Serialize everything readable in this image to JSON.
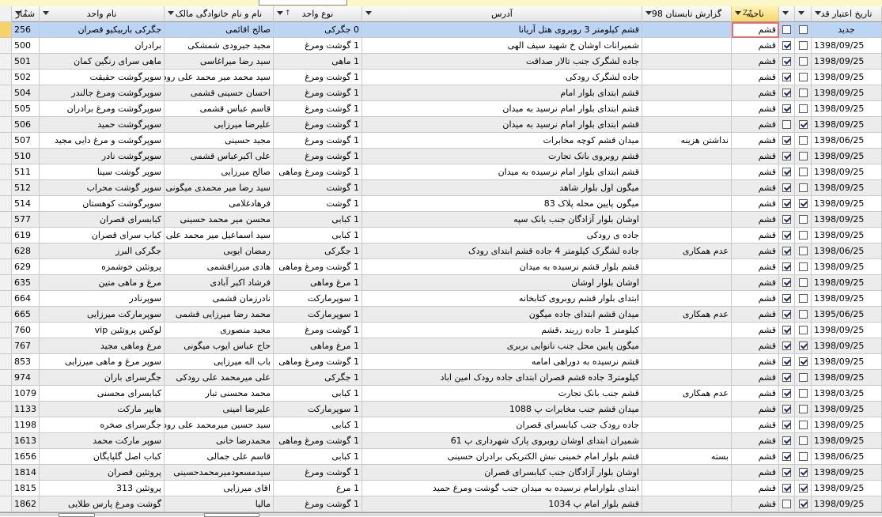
{
  "columns": [
    {
      "key": "num",
      "label": "شمار",
      "sort": true
    },
    {
      "key": "unit_name",
      "label": "نام واحد",
      "sort": false
    },
    {
      "key": "owner",
      "label": "نام و نام خانوادگی مالک",
      "sort": false
    },
    {
      "key": "type",
      "label": "نوع  واحد",
      "sort": true
    },
    {
      "key": "address",
      "label": "آدرس",
      "sort": false
    },
    {
      "key": "report",
      "label": "گزارش تابستان 98",
      "sort": false
    },
    {
      "key": "region",
      "label": "ناحیه",
      "sort": true,
      "sorted": true
    },
    {
      "key": "c1",
      "label": "",
      "sort": false
    },
    {
      "key": "c2",
      "label": "",
      "sort": false
    },
    {
      "key": "date",
      "label": "تاریخ اعتبار قد",
      "sort": false
    }
  ],
  "new_row": {
    "num": "256",
    "unit_name": "جگرکی باربیکیو قصران",
    "owner": "صالح اقائمی",
    "type": "0 جگرکی",
    "address": "قشم کیلومتر 3 روبروی هتل آریانا",
    "report": "",
    "region": "قشم",
    "c1": false,
    "c2": false,
    "date": "جدید"
  },
  "rows": [
    {
      "num": "500",
      "unit_name": "برادران",
      "owner": "مجید جیرودی شمشکی",
      "type": "1 گوشت ومرغ",
      "address": "شمیرانات اوشان خ شهید سیف الهی",
      "report": "",
      "region": "قشم",
      "c1": true,
      "c2": false,
      "date": "1398/09/25"
    },
    {
      "num": "501",
      "unit_name": "ماهی سرای رنگین کمان",
      "owner": "سید رضا میراغاسی",
      "type": "1 ماهی",
      "address": "جاده لشگرک جنب تالار صداقت",
      "report": "",
      "region": "قشم",
      "c1": true,
      "c2": false,
      "date": "1398/09/25"
    },
    {
      "num": "502",
      "unit_name": "سوپرگوشت حقیقت",
      "owner": "سید محمد میر محمد علی رودکی",
      "type": "1 گوشت ومرغ",
      "address": "جاده لشگرک رودکی",
      "report": "",
      "region": "قشم",
      "c1": true,
      "c2": false,
      "date": "1398/09/25"
    },
    {
      "num": "504",
      "unit_name": "سوپرگوشت ومرغ جالندر",
      "owner": "احسان حسینی قشمی",
      "type": "1 گوشت ومرغ",
      "address": "قشم ابتدای بلوار امام",
      "report": "",
      "region": "قشم",
      "c1": true,
      "c2": false,
      "date": "1398/09/25"
    },
    {
      "num": "505",
      "unit_name": "سوپرگوشت ومرغ برادران",
      "owner": "قاسم عباس قشمی",
      "type": "1 گوشت ومرغ",
      "address": "قشم ابتدای بلوار امام نرسید به میدان",
      "report": "",
      "region": "قشم",
      "c1": true,
      "c2": false,
      "date": "1398/09/25"
    },
    {
      "num": "506",
      "unit_name": "سوپرگوشت حمید",
      "owner": "علیرضا میرزایی",
      "type": "1 گوشت ومرغ",
      "address": "قشم ابتدای بلوار امام نرسید به میدان",
      "report": "",
      "region": "قشم",
      "c1": false,
      "c2": true,
      "date": "1398/09/25"
    },
    {
      "num": "507",
      "unit_name": "سوپرگوشت و مرغ دایی مجید",
      "owner": "مجید حسینی",
      "type": "1 گوشت ومرغ",
      "address": "میدان قشم کوچه مخابرات",
      "report": "نداشتن هزینه",
      "region": "قشم",
      "c1": true,
      "c2": false,
      "date": "1398/06/25"
    },
    {
      "num": "510",
      "unit_name": "سوپرگوشت نادر",
      "owner": "علی اکبرعباس قشمی",
      "type": "1 گوشت ومرغ",
      "address": "قشم روبروی بانک تجارت",
      "report": "",
      "region": "قشم",
      "c1": true,
      "c2": false,
      "date": "1398/09/25"
    },
    {
      "num": "511",
      "unit_name": "سوپر گوشت سینا",
      "owner": "صالح میرزایی",
      "type": "1 گوشت ومرغ وماهی",
      "address": "قشم ابتدای بلوار امام نرسیده به میدان",
      "report": "",
      "region": "قشم",
      "c1": true,
      "c2": false,
      "date": "1398/09/25"
    },
    {
      "num": "512",
      "unit_name": "سوپر گوشت محراب",
      "owner": "سید رضا میر محمدی میگونی",
      "type": "1 گوشت",
      "address": "میگون اول بلوار شاهد",
      "report": "",
      "region": "قشم",
      "c1": true,
      "c2": false,
      "date": "1398/09/25"
    },
    {
      "num": "514",
      "unit_name": "سوپرگوشت کوهستان",
      "owner": "فرهادغلامی",
      "type": "1 گوشت",
      "address": "میگون پایین محله پلاک 83",
      "report": "",
      "region": "قشم",
      "c1": true,
      "c2": true,
      "date": "1398/09/25"
    },
    {
      "num": "577",
      "unit_name": "کبابسرای قصران",
      "owner": "محسن میر محمد حسینی",
      "type": "1 کبابی",
      "address": "اوشان بلوار آزادگان جنب بانک سپه",
      "report": "",
      "region": "قشم",
      "c1": true,
      "c2": false,
      "date": "1398/09/25"
    },
    {
      "num": "619",
      "unit_name": "کباب سرای قصران",
      "owner": "سید اسماعیل میر محمد علی رو",
      "type": "1 کبابی",
      "address": "جاده ی رودکی",
      "report": "",
      "region": "قشم",
      "c1": true,
      "c2": false,
      "date": "1398/09/25"
    },
    {
      "num": "628",
      "unit_name": "جگرکی البرز",
      "owner": "رمضان ایوبی",
      "type": "1 جگرکی",
      "address": "جاده لشگرک کیلومتر 4 جاده قشم ابتدای رودک",
      "report": "عدم همکاری",
      "region": "قشم",
      "c1": true,
      "c2": false,
      "date": "1398/06/25"
    },
    {
      "num": "629",
      "unit_name": "پروتئین خوشمزه",
      "owner": "هادی میرزاقشمی",
      "type": "1 گوشت ومرغ وماهی",
      "address": "قشم بلوار قشم نرسیده به میدان",
      "report": "",
      "region": "قشم",
      "c1": true,
      "c2": false,
      "date": "1398/09/25"
    },
    {
      "num": "635",
      "unit_name": "مرغ و ماهی متین",
      "owner": "فرشاد اکبر آبادی",
      "type": "1 مرغ وماهی",
      "address": "اوشان بلوار اوشان",
      "report": "",
      "region": "قشم",
      "c1": true,
      "c2": false,
      "date": "1398/09/25"
    },
    {
      "num": "664",
      "unit_name": "سوپرنادر",
      "owner": "نادرزمان قشمی",
      "type": "1 سوپرمارکت",
      "address": "ابتدای بلوار قشم روبروی کتابخانه",
      "report": "",
      "region": "قشم",
      "c1": true,
      "c2": false,
      "date": "1398/09/25"
    },
    {
      "num": "665",
      "unit_name": "سوپرمارکت میرزایی",
      "owner": "محمد رضا میرزایی قشمی",
      "type": "1 سوپرمارکت",
      "address": "میدان قشم ابتدای جاده میگون",
      "report": "عدم همکاری",
      "region": "قشم",
      "c1": true,
      "c2": false,
      "date": "1395/06/25"
    },
    {
      "num": "760",
      "unit_name": "لوکس پروتئین vip",
      "owner": "مجید منصوری",
      "type": "1 گوشت ومرغ",
      "address": "کیلومتر 1 جاده زربند ،قشم",
      "report": "",
      "region": "قشم",
      "c1": true,
      "c2": false,
      "date": "1398/09/25"
    },
    {
      "num": "767",
      "unit_name": "مرغ وماهی مجید",
      "owner": "حاج عباس ایوب میگونی",
      "type": "1 مرغ وماهی",
      "address": "میگون پایین محل جنب نانوایی بربری",
      "report": "",
      "region": "قشم",
      "c1": true,
      "c2": true,
      "date": "1398/09/25"
    },
    {
      "num": "853",
      "unit_name": "سوپر مرغ و ماهی میرزایی",
      "owner": "باب اله میرزایی",
      "type": "1 گوشت ومرغ وماهی",
      "address": "قشم نرسیده به دوراهی امامه",
      "report": "",
      "region": "قشم",
      "c1": true,
      "c2": true,
      "date": "1398/09/25"
    },
    {
      "num": "974",
      "unit_name": "جگرسرای باران",
      "owner": "علی میرمحمد علی رودکی",
      "type": "1 جگرکی",
      "address": "کیلومتر3 جاده قشم قصران ابتدای جاده رودک امین اباد",
      "report": "",
      "region": "قشم",
      "c1": true,
      "c2": false,
      "date": "1398/09/25"
    },
    {
      "num": "1079",
      "unit_name": "کبابسرای محسنی",
      "owner": "محمد محسنی تبار",
      "type": "1 کبابی",
      "address": "قشم جنب بانک تجارت",
      "report": "عدم همکاری",
      "region": "قشم",
      "c1": true,
      "c2": false,
      "date": "1398/03/25"
    },
    {
      "num": "1133",
      "unit_name": "هایپر مارکت",
      "owner": "علیرضا امینی",
      "type": "1 سوپرمارکت",
      "address": "میدان قشم جنب مخابرات پ 1088",
      "report": "",
      "region": "قشم",
      "c1": true,
      "c2": false,
      "date": "1398/09/25"
    },
    {
      "num": "1198",
      "unit_name": "جگرسرای صخره",
      "owner": "سید حسین میرمحمد علی رودکی",
      "type": "1 کبابی",
      "address": "جاده رودک جنب کبابسرای قصران",
      "report": "",
      "region": "قشم",
      "c1": true,
      "c2": false,
      "date": "1398/09/25"
    },
    {
      "num": "1613",
      "unit_name": "سوپر مارکت محمد",
      "owner": "محمدرضا خانی",
      "type": "1 گوشت ومرغ وماهی",
      "address": "شمیران ابتدای اوشان روبروی پارک شهرداری پ 61",
      "report": "",
      "region": "قشم",
      "c1": true,
      "c2": false,
      "date": "1398/09/25"
    },
    {
      "num": "1656",
      "unit_name": "کباب اصل گلپایگان",
      "owner": "قاسم علی جمالی",
      "type": "1 کبابی",
      "address": "قشم بلوار امام خمینی نبش الکتریکی برادران حسینی",
      "report": "بسته",
      "region": "قشم",
      "c1": true,
      "c2": false,
      "date": "1398/06/25"
    },
    {
      "num": "1814",
      "unit_name": "پروتئین قصران",
      "owner": "سیدمسعودمیرمحمدحسینی",
      "type": "1 گوشت ومرغ",
      "address": "اوشان بلوار آزادگان جنب کبابسرای قصران",
      "report": "",
      "region": "قشم",
      "c1": true,
      "c2": true,
      "date": "1398/09/25"
    },
    {
      "num": "1815",
      "unit_name": "پروتئین 313",
      "owner": "اقای میرزایی",
      "type": "1 مرغ",
      "address": "ابتدای بلوارامام نرسیده به میدان جنب گوشت ومرغ حمید",
      "report": "",
      "region": "قشم",
      "c1": true,
      "c2": true,
      "date": "1398/09/25"
    },
    {
      "num": "1862",
      "unit_name": "گوشت ومرغ پارس طلایی",
      "owner": "مالیا",
      "type": "1 گوشت ومرغ",
      "address": "قشم بلوار امام پ 1034",
      "report": "",
      "region": "قشم",
      "c1": false,
      "c2": true,
      "date": "1398/09/25"
    }
  ]
}
